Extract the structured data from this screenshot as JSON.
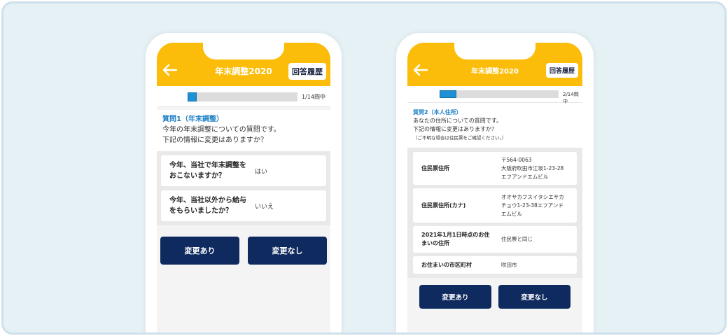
{
  "phone1": {
    "header_title": "年末調整2020",
    "history_button": "回答履歴",
    "progress_text": "1/14問中",
    "progress_fraction": 0.08,
    "question_title": "質問1（年末調整）",
    "question_line1": "今年の年末調整についての質問です。",
    "question_line2": "下記の情報に変更はありますか？",
    "rows": [
      {
        "label_line1": "今年、当社で年末調整を",
        "label_line2": "おこないますか？",
        "value": "はい"
      },
      {
        "label_line1": "今年、当社以外から給与",
        "label_line2": "をもらいましたか？",
        "value": "いいえ"
      }
    ],
    "btn_change": "変更あり",
    "btn_nochange": "変更なし"
  },
  "phone2": {
    "header_title": "年末調整2020",
    "history_button": "回答履歴",
    "progress_text": "2/14問中",
    "progress_fraction": 0.14,
    "question_title": "質問2（本人住所）",
    "question_line1": "あなたの住所についての質問です。",
    "question_line2": "下記の情報に変更はありますか？",
    "question_note": "（ご不明な場合は住民票をご確認ください。）",
    "rows": [
      {
        "label_line1": "住民票住所",
        "label_line2": "",
        "value_line1": "〒564-0063",
        "value_line2": "大阪府吹田市江坂1-23-28",
        "value_line3": "エフアンドエムビル"
      },
      {
        "label_line1": "住民票住所(カナ)",
        "label_line2": "",
        "value_line1": "オオサカフスイタシエサカ",
        "value_line2": "チョウ1-23-38エフアンド",
        "value_line3": "エムビル"
      },
      {
        "label_line1": "2021年1月1日時点のお住",
        "label_line2": "まいの住所",
        "value_line1": "住民票と同じ",
        "value_line2": "",
        "value_line3": ""
      },
      {
        "label_line1": "お住まいの市区町村",
        "label_line2": "",
        "value_line1": "吹田市",
        "value_line2": "",
        "value_line3": ""
      }
    ],
    "btn_change": "変更あり",
    "btn_nochange": "変更なし"
  },
  "colors": {
    "header": "#fbbd09",
    "button": "#0f2a5e",
    "accent": "#1e7fc4",
    "background": "#e6f1f6"
  }
}
